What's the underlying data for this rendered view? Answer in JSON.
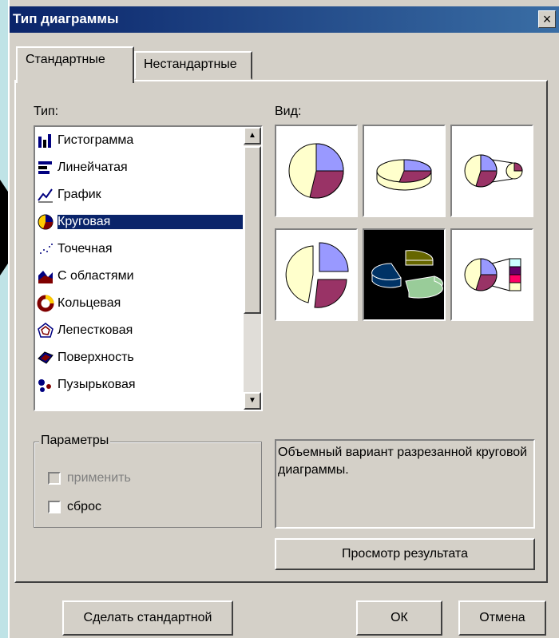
{
  "window": {
    "title": "Тип диаграммы",
    "close_glyph": "×"
  },
  "tabs": [
    {
      "label": "Стандартные",
      "active": true
    },
    {
      "label": "Нестандартные",
      "active": false
    }
  ],
  "type_label": "Тип:",
  "view_label": "Вид:",
  "chart_types": [
    {
      "label": "Гистограмма",
      "icon": "column-chart-icon"
    },
    {
      "label": "Линейчатая",
      "icon": "bar-chart-icon"
    },
    {
      "label": "График",
      "icon": "line-chart-icon"
    },
    {
      "label": "Круговая",
      "icon": "pie-chart-icon",
      "selected": true
    },
    {
      "label": "Точечная",
      "icon": "scatter-chart-icon"
    },
    {
      "label": "С областями",
      "icon": "area-chart-icon"
    },
    {
      "label": "Кольцевая",
      "icon": "doughnut-chart-icon"
    },
    {
      "label": "Лепестковая",
      "icon": "radar-chart-icon"
    },
    {
      "label": "Поверхность",
      "icon": "surface-chart-icon"
    },
    {
      "label": "Пузырьковая",
      "icon": "bubble-chart-icon"
    }
  ],
  "scroll": {
    "up": "▲",
    "down": "▼"
  },
  "views": [
    "pie",
    "pie-3d",
    "pie-of-pie",
    "exploded-pie",
    "exploded-pie-3d",
    "bar-of-pie"
  ],
  "selected_view_index": 4,
  "parameters": {
    "legend": "Параметры",
    "apply_label": "применить",
    "reset_label": "сброс"
  },
  "description": "Объемный вариант разрезанной круговой диаграммы.",
  "buttons": {
    "preview": "Просмотр результата",
    "make_default": "Сделать стандартной",
    "ok": "ОК",
    "cancel": "Отмена"
  },
  "colors": {
    "pie_a": "#ffffcc",
    "pie_b": "#9999ff",
    "pie_c": "#993366",
    "pie3d_a": "#003366",
    "pie3d_b": "#99cc99",
    "pie3d_c": "#666600"
  }
}
